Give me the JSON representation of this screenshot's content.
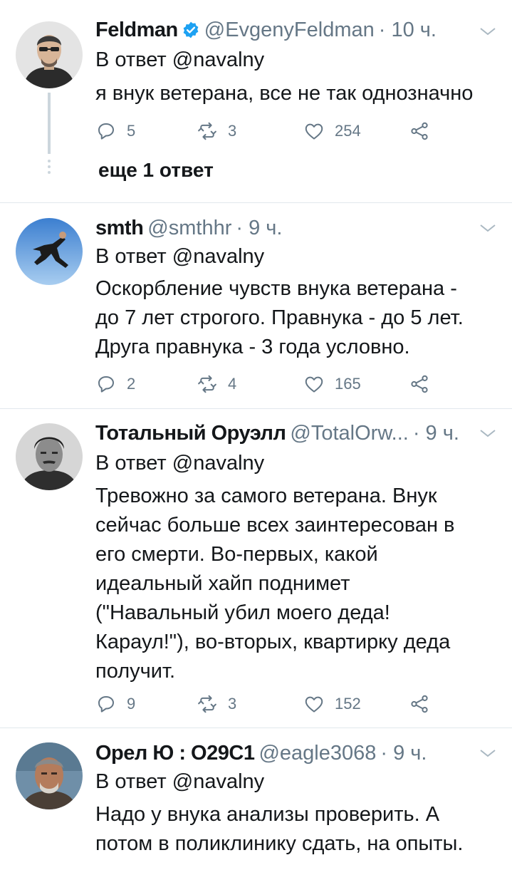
{
  "colors": {
    "muted": "#657786",
    "text": "#14171a",
    "verified": "#1da1f2",
    "divider": "#e1e8ed"
  },
  "tweets": [
    {
      "name": "Feldman",
      "handle": "@EvgenyFeldman",
      "time": "· 10 ч.",
      "verified": true,
      "reply_to": "В ответ @navalny",
      "text": "я внук ветерана, все не так однозначно",
      "replies": "5",
      "retweets": "3",
      "likes": "254",
      "more_replies": "еще 1 ответ"
    },
    {
      "name": "smth",
      "handle": "@smthhr",
      "time": "· 9 ч.",
      "reply_to": "В ответ @navalny",
      "text": "Оскорбление чувств внука ветерана -\nдо 7 лет строгого. Правнука - до 5 лет.\nДруга правнука - 3 года условно.",
      "replies": "2",
      "retweets": "4",
      "likes": "165"
    },
    {
      "name": "Тотальный Оруэлл",
      "handle": "@TotalOrw...",
      "time": "· 9 ч.",
      "reply_to": "В ответ @navalny",
      "text": "Тревожно за самого ветерана. Внук\nсейчас больше всех заинтересован в\nего смерти. Во-первых, какой\nидеальный хайп поднимет\n(\"Навальный убил моего деда!\nКараул!\"), во-вторых, квартирку деда\nполучит.",
      "replies": "9",
      "retweets": "3",
      "likes": "152"
    },
    {
      "name": "Орел Ю : O29C1",
      "handle": "@eagle3068",
      "time": "· 9 ч.",
      "reply_to": "В ответ @navalny",
      "text": "Надо у внука анализы проверить. А\nпотом в поликлинику сдать, на опыты."
    }
  ]
}
